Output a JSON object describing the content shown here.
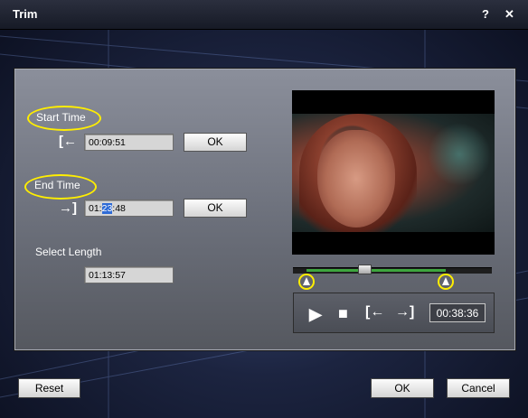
{
  "window": {
    "title": "Trim",
    "help_label": "?",
    "close_label": "✕"
  },
  "start": {
    "label": "Start Time",
    "value": "00:09:51",
    "ok_label": "OK",
    "icon": "set-start-icon"
  },
  "end": {
    "label": "End Time",
    "value_prefix": "01:",
    "value_selected": "23",
    "value_suffix": ":48",
    "ok_label": "OK",
    "icon": "set-end-icon"
  },
  "length": {
    "label": "Select Length",
    "value": "01:13:57"
  },
  "player": {
    "time": "00:38:36",
    "play_icon": "▶",
    "stop_icon": "■",
    "set_start_icon": "[←",
    "set_end_icon": "→]",
    "trim_start_fraction": 0.07,
    "trim_end_fraction": 0.77,
    "playhead_fraction": 0.36
  },
  "footer": {
    "reset_label": "Reset",
    "ok_label": "OK",
    "cancel_label": "Cancel"
  },
  "colors": {
    "highlight_ring": "#ffee00",
    "timeline_range": "#3ea63e"
  }
}
